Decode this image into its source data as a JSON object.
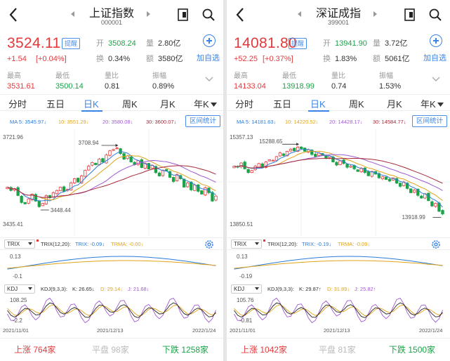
{
  "colors": {
    "up": "#e4393c",
    "down": "#1ba348",
    "accent": "#3a84e8",
    "ma5": "#2b7bd6",
    "ma10": "#e0a31a",
    "ma20": "#a05ad2",
    "ma30": "#a52a3a"
  },
  "common": {
    "remind_label": "提醒",
    "add_label": "加自选",
    "labels": {
      "open": "开",
      "amount": "量",
      "turnover": "换",
      "value": "额",
      "high": "最高",
      "low": "最低",
      "ratio": "量比",
      "amplitude": "振幅"
    },
    "tabs": [
      "分时",
      "五日",
      "日K",
      "周K",
      "月K",
      "年K"
    ],
    "interval_label": "区间统计",
    "indicator_select_1": "TRIX",
    "indicator_select_2": "KDJ",
    "bottom_labels": {
      "up": "上涨",
      "flat": "平盘",
      "down": "下跌"
    },
    "dates": [
      "2021/11/01",
      "2021/12/13",
      "2022/1/24"
    ],
    "icons": [
      "back-icon",
      "share-icon",
      "search-icon",
      "plus-circle-icon",
      "chevron-down-icon",
      "gear-icon",
      "caret-down-icon"
    ]
  },
  "panels": [
    {
      "name": "上证指数",
      "code": "000001",
      "price": "3524.11",
      "change": "+1.54",
      "change_pct": "[+0.04%]",
      "open": "3508.24",
      "amount": "2.80亿",
      "turnover": "0.34%",
      "value": "3580亿",
      "high": "3531.61",
      "low": "3500.14",
      "ratio": "0.81",
      "amplitude": "0.89%",
      "ma_texts": [
        "MA 5: 3545.97↓",
        "10: 3551.29↓",
        "20: 3580.08↓",
        "30: 3600.07↓"
      ],
      "axis_top": "3721.96",
      "axis_bottom": "3435.41",
      "max_label": "3708.94",
      "min_label": "3448.44",
      "trix_params": "TRIX(12,20):",
      "trix_val": "TRIX: -0.09↓",
      "trma_val": "TRMA: -0.00↓",
      "trix_axis_top": "0.13",
      "trix_axis_bottom": "-0.1",
      "kdj_params": "KDJ(9,3,3):",
      "k_val": "K: 26.65↓",
      "d_val": "D: 29.14↓",
      "j_val": "J: 21.68↓",
      "kdj_axis_top": "108.25",
      "kdj_axis_bottom": "-2.2",
      "up_count": "764家",
      "flat_count": "98家",
      "down_count": "1258家",
      "chart_data": {
        "type": "candlestick",
        "y_range": [
          3435.41,
          3721.96
        ],
        "closes": [
          3560,
          3548,
          3555,
          3530,
          3505,
          3500,
          3518,
          3535,
          3510,
          3490,
          3502,
          3530,
          3522,
          3540,
          3548,
          3560,
          3545,
          3552,
          3575,
          3590,
          3578,
          3600,
          3620,
          3635,
          3648,
          3640,
          3660,
          3650,
          3675,
          3690,
          3695,
          3700,
          3680,
          3660,
          3672,
          3650,
          3640,
          3655,
          3630,
          3645,
          3625,
          3638,
          3612,
          3600,
          3620,
          3618,
          3595,
          3580,
          3605,
          3590,
          3560,
          3575,
          3550,
          3568,
          3545,
          3535,
          3558,
          3540,
          3510,
          3528
        ]
      }
    },
    {
      "name": "深证成指",
      "code": "399001",
      "price": "14081.80",
      "change": "+52.25",
      "change_pct": "[+0.37%]",
      "open": "13941.90",
      "amount": "3.72亿",
      "turnover": "1.83%",
      "value": "5061亿",
      "high": "14133.04",
      "low": "13918.99",
      "ratio": "0.74",
      "amplitude": "1.53%",
      "ma_texts": [
        "MA 5: 14181.63↓",
        "10: 14220.52↓",
        "20: 14428.17↓",
        "30: 14584.77↓"
      ],
      "axis_top": "15357.13",
      "axis_bottom": "13850.51",
      "max_label": "15288.65",
      "min_label": "13918.99",
      "trix_params": "TRIX(12,20):",
      "trix_val": "TRIX: -0.19↓",
      "trma_val": "TRMA: -0.09↓",
      "trix_axis_top": "0.13",
      "trix_axis_bottom": "-0.19",
      "kdj_params": "KDJ(9,3,3):",
      "k_val": "K: 29.87↑",
      "d_val": "D: 31.89↓",
      "j_val": "J: 25.82↑",
      "kdj_axis_top": "105.76",
      "kdj_axis_bottom": "-0.81",
      "up_count": "1042家",
      "flat_count": "81家",
      "down_count": "1500家",
      "chart_data": {
        "type": "candlestick",
        "y_range": [
          13850.51,
          15357.13
        ],
        "closes": [
          14900,
          14880,
          14960,
          14850,
          14780,
          14820,
          14900,
          14950,
          14870,
          14980,
          15020,
          15010,
          15080,
          15150,
          15100,
          15180,
          15220,
          15190,
          15260,
          15230,
          15180,
          15210,
          15120,
          15080,
          15150,
          15100,
          15050,
          15090,
          14980,
          14920,
          15000,
          14950,
          14880,
          14900,
          14850,
          14800,
          14860,
          14780,
          14720,
          14800,
          14750,
          14680,
          14700,
          14650,
          14620,
          14680,
          14580,
          14520,
          14600,
          14480,
          14400,
          14450,
          14350,
          14300,
          14380,
          14250,
          14150,
          14200,
          14050,
          14000
        ]
      }
    }
  ]
}
